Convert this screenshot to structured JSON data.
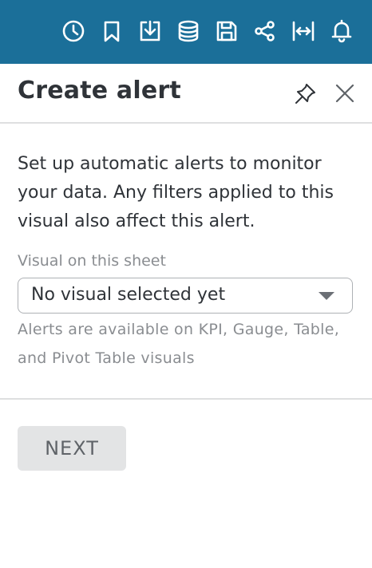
{
  "toolbar": {
    "icons": [
      "clock-icon",
      "bookmark-icon",
      "download-icon",
      "database-icon",
      "save-icon",
      "share-icon",
      "fit-width-icon",
      "bell-icon"
    ],
    "background_color": "#1b6f99"
  },
  "panel": {
    "title": "Create alert",
    "description": "Set up automatic alerts to monitor your data. Any filters applied to this visual also affect this alert.",
    "visual_field": {
      "label": "Visual on this sheet",
      "selected_value": "No visual selected yet"
    },
    "help_text": "Alerts are available on KPI, Gauge, Table, and Pivot Table visuals",
    "next_button_label": "NEXT"
  }
}
